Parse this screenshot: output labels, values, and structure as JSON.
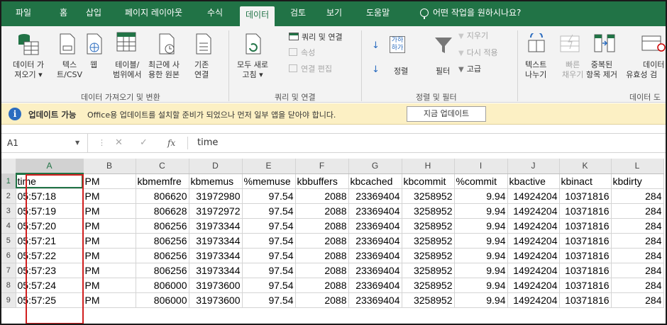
{
  "tabs": [
    "파일",
    "홈",
    "삽입",
    "페이지 레이아웃",
    "수식",
    "데이터",
    "검토",
    "보기",
    "도움말"
  ],
  "tell_me": "어떤 작업을 원하시나요?",
  "ribbon": {
    "get_data": [
      "데이터 가",
      "져오기 ▾"
    ],
    "text_csv": [
      "텍스",
      "트/CSV"
    ],
    "web": "웹",
    "table_range": [
      "테이블/",
      "범위에서"
    ],
    "recent_sources": [
      "최근에 사",
      "용한 원본"
    ],
    "existing_conn": [
      "기존",
      "연결"
    ],
    "group_get_transform": "데이터 가져오기 및 변환",
    "refresh_all": [
      "모두 새로",
      "고침 ▾"
    ],
    "queries_conn": "쿼리 및 연결",
    "properties": "속성",
    "edit_links": "연결 편집",
    "group_queries": "쿼리 및 연결",
    "sort": "정렬",
    "filter": "필터",
    "clear": "지우기",
    "reapply": "다시 적용",
    "advanced": "고급",
    "group_sort_filter": "정렬 및 필터",
    "text_to_cols": [
      "텍스트",
      "나누기"
    ],
    "flash_fill": [
      "빠른",
      "채우기"
    ],
    "remove_dup": [
      "중복된",
      "항목 제거"
    ],
    "data_validation": [
      "데이터",
      "유효성 검"
    ],
    "group_data_tools": "데이터 도"
  },
  "message_bar": {
    "title": "업데이트 가능",
    "text": "Office용 업데이트를 설치할 준비가 되었으나 먼저 일부 앱을 닫아야 합니다.",
    "button": "지금 업데이트"
  },
  "formula_bar": {
    "name_box": "A1",
    "content": "time"
  },
  "sheet": {
    "columns": [
      "A",
      "B",
      "C",
      "D",
      "E",
      "F",
      "G",
      "H",
      "I",
      "J",
      "K",
      "L"
    ],
    "headers": [
      "time",
      "PM",
      "kbmemfre",
      "kbmemus",
      "%memuse",
      "kbbuffers",
      "kbcached",
      "kbcommit",
      "%commit",
      "kbactive",
      "kbinact",
      "kbdirty"
    ],
    "row_numbers": [
      "1",
      "2",
      "3",
      "4",
      "5",
      "6",
      "7",
      "8",
      "9"
    ],
    "rows": [
      [
        "05:57:18",
        "PM",
        "806620",
        "31972980",
        "97.54",
        "2088",
        "23369404",
        "3258952",
        "9.94",
        "14924204",
        "10371816",
        "284"
      ],
      [
        "05:57:19",
        "PM",
        "806628",
        "31972972",
        "97.54",
        "2088",
        "23369404",
        "3258952",
        "9.94",
        "14924204",
        "10371816",
        "284"
      ],
      [
        "05:57:20",
        "PM",
        "806256",
        "31973344",
        "97.54",
        "2088",
        "23369404",
        "3258952",
        "9.94",
        "14924204",
        "10371816",
        "284"
      ],
      [
        "05:57:21",
        "PM",
        "806256",
        "31973344",
        "97.54",
        "2088",
        "23369404",
        "3258952",
        "9.94",
        "14924204",
        "10371816",
        "284"
      ],
      [
        "05:57:22",
        "PM",
        "806256",
        "31973344",
        "97.54",
        "2088",
        "23369404",
        "3258952",
        "9.94",
        "14924204",
        "10371816",
        "284"
      ],
      [
        "05:57:23",
        "PM",
        "806256",
        "31973344",
        "97.54",
        "2088",
        "23369404",
        "3258952",
        "9.94",
        "14924204",
        "10371816",
        "284"
      ],
      [
        "05:57:24",
        "PM",
        "806000",
        "31973600",
        "97.54",
        "2088",
        "23369404",
        "3258952",
        "9.94",
        "14924204",
        "10371816",
        "284"
      ],
      [
        "05:57:25",
        "PM",
        "806000",
        "31973600",
        "97.54",
        "2088",
        "23369404",
        "3258952",
        "9.94",
        "14924204",
        "10371816",
        "284"
      ]
    ]
  },
  "colors": {
    "excel_green": "#217346",
    "highlight_red": "#d11f1f",
    "message_bg": "#fcf0c4"
  }
}
